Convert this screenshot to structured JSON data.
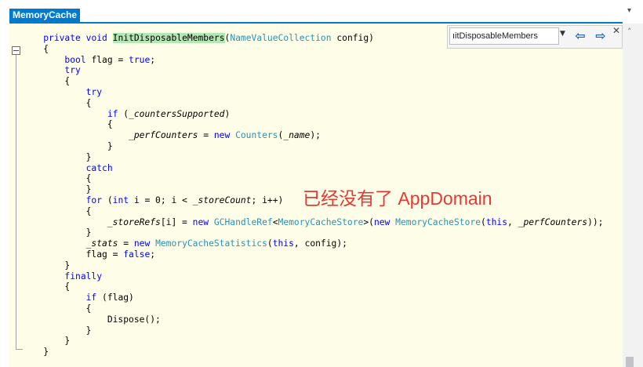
{
  "tab": {
    "title": "MemoryCache"
  },
  "find": {
    "query": "InitDisposableMembers",
    "display": "ıitDisposableMembers"
  },
  "annotation": "已经没有了 AppDomain",
  "colors": {
    "keyword": "#0000ff",
    "type": "#2b91af",
    "highlight": "#b5e7b5",
    "annotation": "#e53935",
    "tab": "#007acc"
  },
  "icons": {
    "find_prev": "arrow-left-icon",
    "find_next": "arrow-right-icon",
    "close": "close-icon",
    "collapse": "collapse-minus-icon"
  },
  "code": [
    {
      "indent": 1,
      "tokens": [
        [
          "kw",
          "private"
        ],
        [
          "t",
          " "
        ],
        [
          "kw",
          "void"
        ],
        [
          "t",
          " "
        ],
        [
          "hl",
          "InitDisposableMembers"
        ],
        [
          "t",
          "("
        ],
        [
          "ty",
          "NameValueCollection"
        ],
        [
          "t",
          " config)"
        ]
      ]
    },
    {
      "indent": 1,
      "tokens": [
        [
          "t",
          "{"
        ]
      ]
    },
    {
      "indent": 2,
      "tokens": [
        [
          "kw",
          "bool"
        ],
        [
          "t",
          " flag = "
        ],
        [
          "kw",
          "true"
        ],
        [
          "t",
          ";"
        ]
      ]
    },
    {
      "indent": 2,
      "tokens": [
        [
          "kw",
          "try"
        ]
      ]
    },
    {
      "indent": 2,
      "tokens": [
        [
          "t",
          "{"
        ]
      ]
    },
    {
      "indent": 3,
      "tokens": [
        [
          "kw",
          "try"
        ]
      ]
    },
    {
      "indent": 3,
      "tokens": [
        [
          "t",
          "{"
        ]
      ]
    },
    {
      "indent": 4,
      "tokens": [
        [
          "kw",
          "if"
        ],
        [
          "t",
          " ("
        ],
        [
          "fld",
          "_countersSupported"
        ],
        [
          "t",
          ")"
        ]
      ]
    },
    {
      "indent": 4,
      "tokens": [
        [
          "t",
          "{"
        ]
      ]
    },
    {
      "indent": 5,
      "tokens": [
        [
          "fld",
          "_perfCounters"
        ],
        [
          "t",
          " = "
        ],
        [
          "kw",
          "new"
        ],
        [
          "t",
          " "
        ],
        [
          "ty",
          "Counters"
        ],
        [
          "t",
          "("
        ],
        [
          "fld",
          "_name"
        ],
        [
          "t",
          ");"
        ]
      ]
    },
    {
      "indent": 4,
      "tokens": [
        [
          "t",
          "}"
        ]
      ]
    },
    {
      "indent": 3,
      "tokens": [
        [
          "t",
          "}"
        ]
      ]
    },
    {
      "indent": 3,
      "tokens": [
        [
          "kw",
          "catch"
        ]
      ]
    },
    {
      "indent": 3,
      "tokens": [
        [
          "t",
          "{"
        ]
      ]
    },
    {
      "indent": 3,
      "tokens": [
        [
          "t",
          "}"
        ]
      ]
    },
    {
      "indent": 3,
      "tokens": [
        [
          "kw",
          "for"
        ],
        [
          "t",
          " ("
        ],
        [
          "kw",
          "int"
        ],
        [
          "t",
          " i = 0; i < "
        ],
        [
          "fld",
          "_storeCount"
        ],
        [
          "t",
          "; i++)"
        ]
      ]
    },
    {
      "indent": 3,
      "tokens": [
        [
          "t",
          "{"
        ]
      ]
    },
    {
      "indent": 4,
      "tokens": [
        [
          "fld",
          "_storeRefs"
        ],
        [
          "t",
          "[i] = "
        ],
        [
          "kw",
          "new"
        ],
        [
          "t",
          " "
        ],
        [
          "ty",
          "GCHandleRef"
        ],
        [
          "t",
          "<"
        ],
        [
          "ty",
          "MemoryCacheStore"
        ],
        [
          "t",
          ">("
        ],
        [
          "kw",
          "new"
        ],
        [
          "t",
          " "
        ],
        [
          "ty",
          "MemoryCacheStore"
        ],
        [
          "t",
          "("
        ],
        [
          "kw",
          "this"
        ],
        [
          "t",
          ", "
        ],
        [
          "fld",
          "_perfCounters"
        ],
        [
          "t",
          "));"
        ]
      ]
    },
    {
      "indent": 3,
      "tokens": [
        [
          "t",
          "}"
        ]
      ]
    },
    {
      "indent": 3,
      "tokens": [
        [
          "fld",
          "_stats"
        ],
        [
          "t",
          " = "
        ],
        [
          "kw",
          "new"
        ],
        [
          "t",
          " "
        ],
        [
          "ty",
          "MemoryCacheStatistics"
        ],
        [
          "t",
          "("
        ],
        [
          "kw",
          "this"
        ],
        [
          "t",
          ", config);"
        ]
      ]
    },
    {
      "indent": 3,
      "tokens": [
        [
          "t",
          "flag = "
        ],
        [
          "kw",
          "false"
        ],
        [
          "t",
          ";"
        ]
      ]
    },
    {
      "indent": 2,
      "tokens": [
        [
          "t",
          "}"
        ]
      ]
    },
    {
      "indent": 2,
      "tokens": [
        [
          "kw",
          "finally"
        ]
      ]
    },
    {
      "indent": 2,
      "tokens": [
        [
          "t",
          "{"
        ]
      ]
    },
    {
      "indent": 3,
      "tokens": [
        [
          "kw",
          "if"
        ],
        [
          "t",
          " (flag)"
        ]
      ]
    },
    {
      "indent": 3,
      "tokens": [
        [
          "t",
          "{"
        ]
      ]
    },
    {
      "indent": 4,
      "tokens": [
        [
          "t",
          "Dispose();"
        ]
      ]
    },
    {
      "indent": 3,
      "tokens": [
        [
          "t",
          "}"
        ]
      ]
    },
    {
      "indent": 2,
      "tokens": [
        [
          "t",
          "}"
        ]
      ]
    },
    {
      "indent": 1,
      "tokens": [
        [
          "t",
          "}"
        ]
      ]
    }
  ]
}
